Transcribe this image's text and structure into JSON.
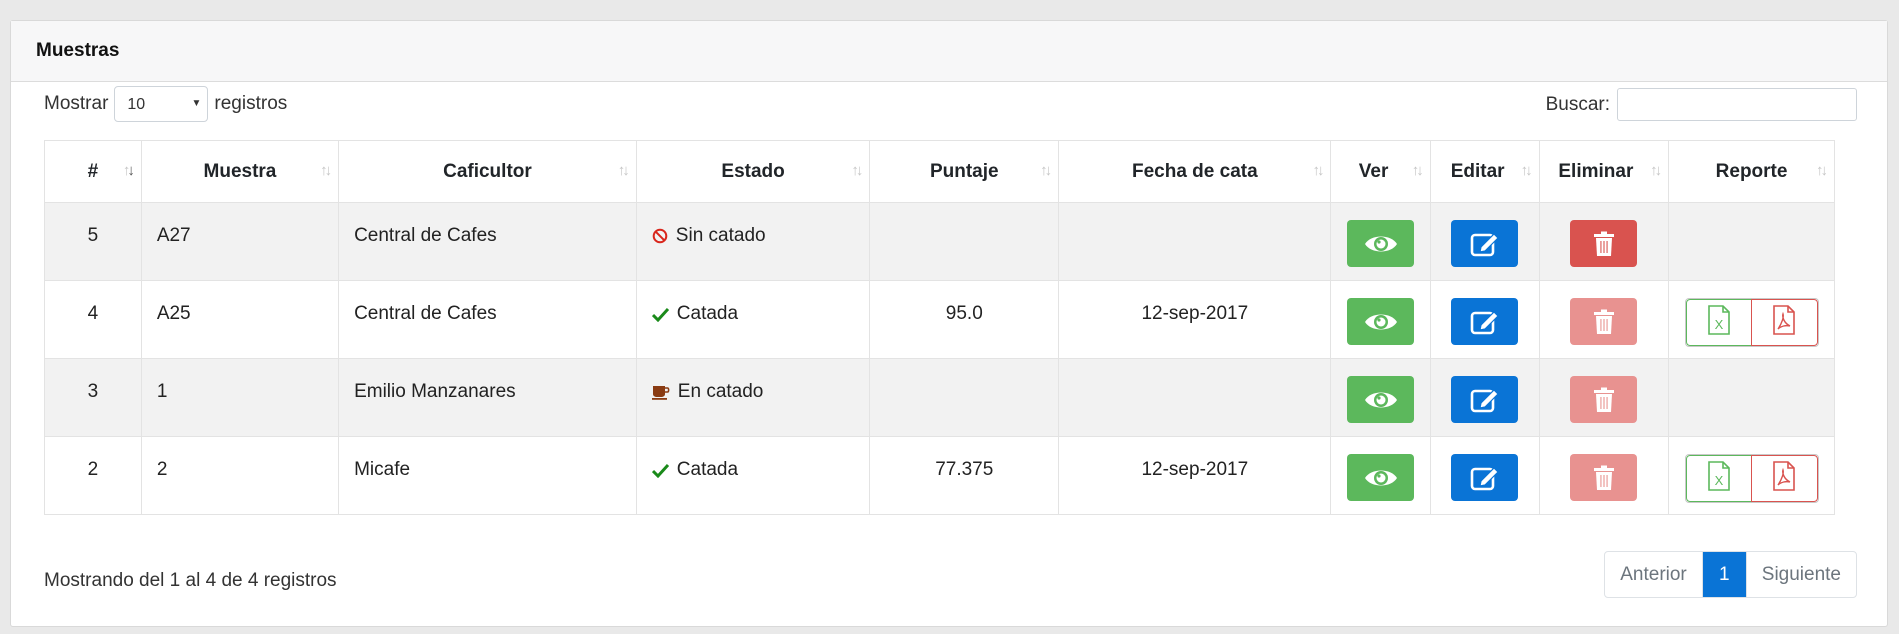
{
  "panel": {
    "title": "Muestras"
  },
  "length_control": {
    "prefix": "Mostrar",
    "selected": "10",
    "suffix": "registros"
  },
  "search": {
    "label": "Buscar:",
    "value": ""
  },
  "table": {
    "headers": [
      "#",
      "Muestra",
      "Caficultor",
      "Estado",
      "Puntaje",
      "Fecha de cata",
      "Ver",
      "Editar",
      "Eliminar",
      "Reporte"
    ],
    "rows": [
      {
        "num": "5",
        "muestra": "A27",
        "caficultor": "Central de Cafes",
        "estado": "Sin catado",
        "estado_icon": "ban-icon",
        "puntaje": "",
        "fecha": "",
        "eliminar_enabled": true,
        "has_report": false
      },
      {
        "num": "4",
        "muestra": "A25",
        "caficultor": "Central de Cafes",
        "estado": "Catada",
        "estado_icon": "check-icon",
        "puntaje": "95.0",
        "fecha": "12-sep-2017",
        "eliminar_enabled": false,
        "has_report": true
      },
      {
        "num": "3",
        "muestra": "1",
        "caficultor": "Emilio Manzanares",
        "estado": "En catado",
        "estado_icon": "coffee-icon",
        "puntaje": "",
        "fecha": "",
        "eliminar_enabled": false,
        "has_report": false
      },
      {
        "num": "2",
        "muestra": "2",
        "caficultor": "Micafe",
        "estado": "Catada",
        "estado_icon": "check-icon",
        "puntaje": "77.375",
        "fecha": "12-sep-2017",
        "eliminar_enabled": false,
        "has_report": true
      }
    ]
  },
  "info": "Mostrando del 1 al 4 de 4 registros",
  "pagination": {
    "prev": "Anterior",
    "current": "1",
    "next": "Siguiente"
  },
  "colors": {
    "view": "#5cb85c",
    "edit": "#0a74d6",
    "delete": "#d9534f",
    "delete_disabled": "#e89290",
    "excel": "#5cb85c",
    "pdf": "#d9534f",
    "check": "#1a8a1a",
    "ban": "#d9261c",
    "coffee": "#8a3b12"
  }
}
